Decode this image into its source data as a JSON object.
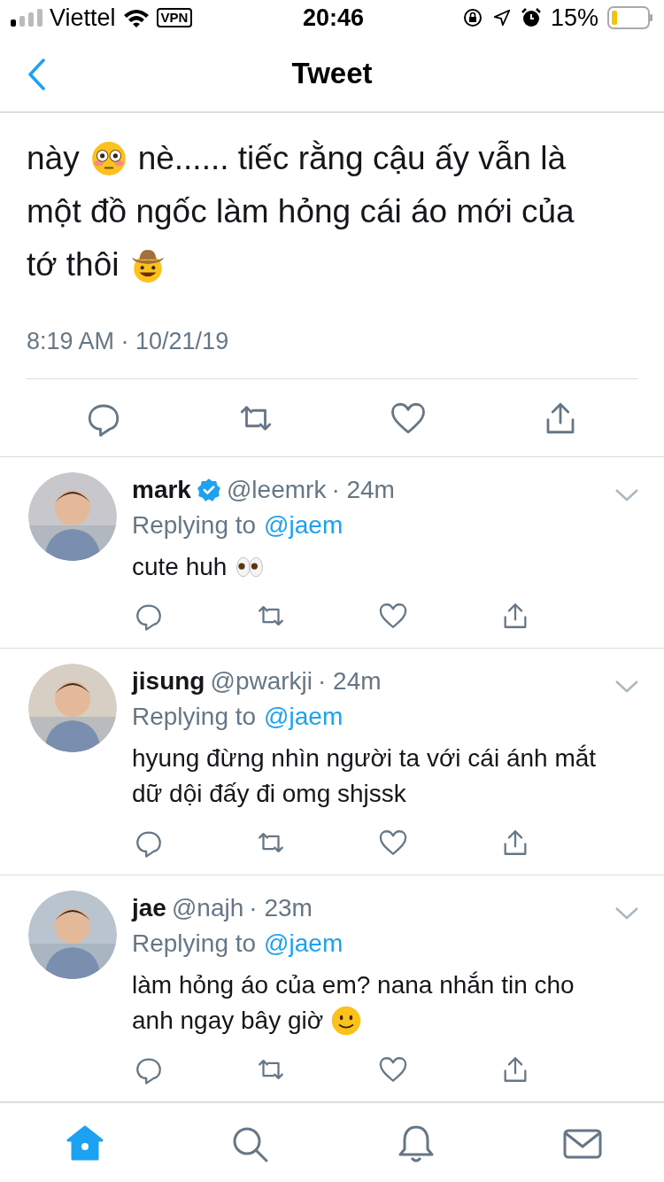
{
  "status_bar": {
    "carrier": "Viettel",
    "vpn": "VPN",
    "time": "20:46",
    "battery": "15%"
  },
  "header": {
    "title": "Tweet"
  },
  "tweet": {
    "lines": [
      [
        {
          "kind": "text",
          "text": "này"
        },
        {
          "kind": "flushed_face"
        },
        {
          "kind": "text",
          "text": "nè...... tiếc rằng cậu ấy vẫn là"
        }
      ],
      [
        {
          "kind": "text",
          "text": "một đồ ngốc làm hỏng cái áo mới của"
        }
      ],
      [
        {
          "kind": "text",
          "text": "tớ thôi"
        },
        {
          "kind": "cowboy_face"
        }
      ]
    ],
    "timestamp": "8:19 AM · 10/21/19"
  },
  "replies": [
    {
      "name": "mark",
      "verified": true,
      "handle": "@leemrk",
      "time": "· 24m",
      "replying_label": "Replying to",
      "replying_to": "@jaem",
      "lines": [
        [
          {
            "kind": "text",
            "text": "cute huh"
          },
          {
            "kind": "eyes"
          }
        ]
      ]
    },
    {
      "name": "jisung",
      "verified": false,
      "handle": "@pwarkji",
      "time": "· 24m",
      "replying_label": "Replying to",
      "replying_to": "@jaem",
      "lines": [
        [
          {
            "kind": "text",
            "text": "hyung đừng nhìn người ta với cái ánh mắt"
          }
        ],
        [
          {
            "kind": "text",
            "text": "dữ dội đấy đi omg shjssk"
          }
        ]
      ]
    },
    {
      "name": "jae",
      "verified": false,
      "handle": "@najh",
      "time": "· 23m",
      "replying_label": "Replying to",
      "replying_to": "@jaem",
      "lines": [
        [
          {
            "kind": "text",
            "text": "làm hỏng áo của em? nana nhắn tin cho"
          }
        ],
        [
          {
            "kind": "text",
            "text": "anh ngay bây giờ"
          },
          {
            "kind": "smile_face"
          }
        ]
      ]
    }
  ],
  "tab_bar": [
    {
      "kind": "home",
      "selected": true
    },
    {
      "kind": "search",
      "selected": false
    },
    {
      "kind": "notifications",
      "selected": false
    },
    {
      "kind": "messages",
      "selected": false
    }
  ]
}
